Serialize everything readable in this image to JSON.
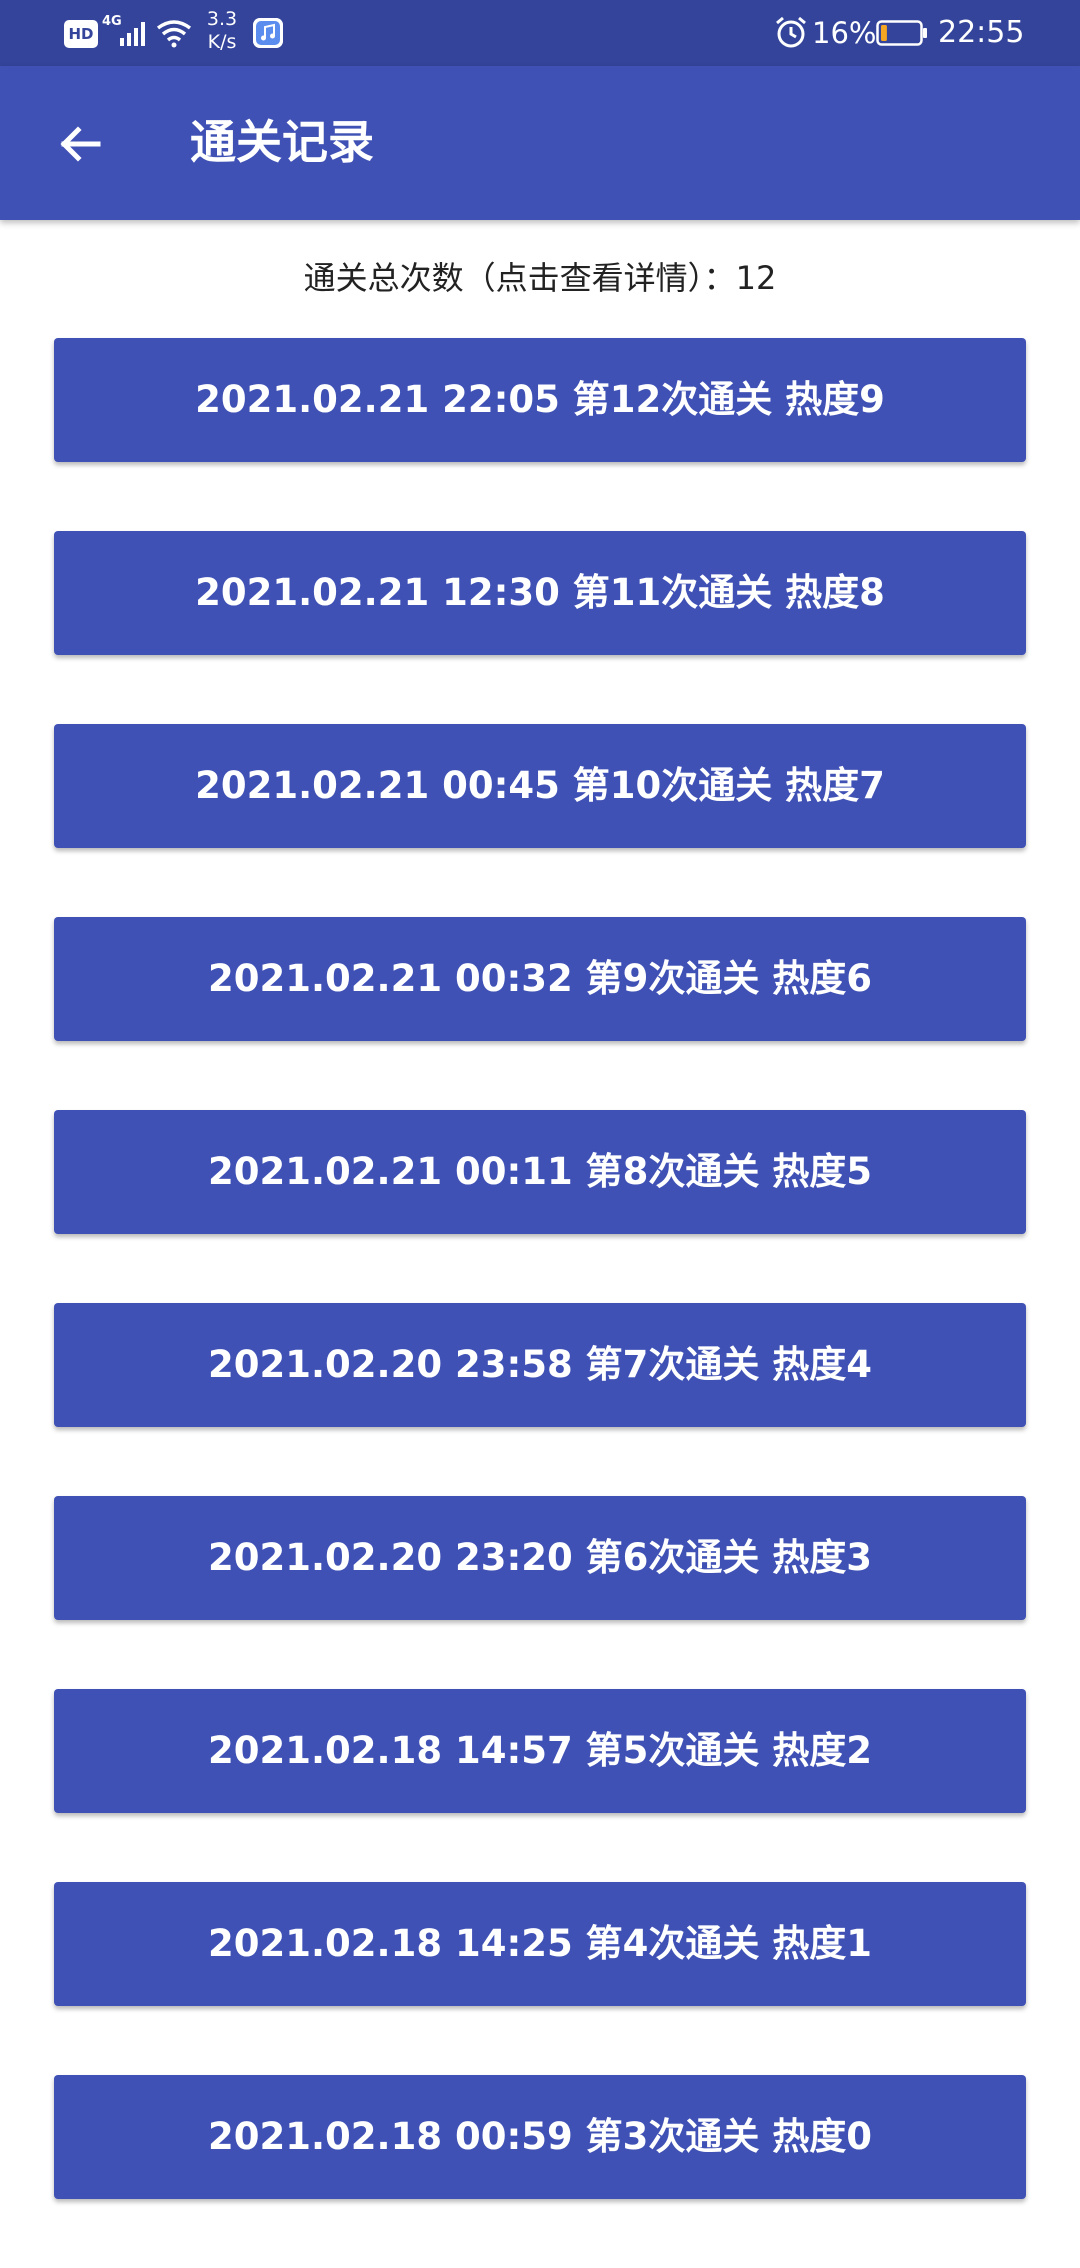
{
  "status_bar": {
    "hd": "HD",
    "network": "4G",
    "speed_value": "3.3",
    "speed_unit": "K/s",
    "battery_percent": "16%",
    "battery_level": 0.16,
    "time": "22:55",
    "icons": [
      "hd-icon",
      "signal-icon",
      "wifi-icon",
      "music-app-icon",
      "alarm-icon",
      "battery-icon"
    ]
  },
  "app_bar": {
    "back_icon": "arrow-left-icon",
    "title": "通关记录"
  },
  "summary": {
    "label": "通关总次数（点击查看详情）：",
    "count": "12"
  },
  "records": [
    {
      "label": "2021.02.21 22:05 第12次通关 热度9"
    },
    {
      "label": "2021.02.21 12:30 第11次通关 热度8"
    },
    {
      "label": "2021.02.21 00:45 第10次通关 热度7"
    },
    {
      "label": "2021.02.21 00:32 第9次通关 热度6"
    },
    {
      "label": "2021.02.21 00:11 第8次通关 热度5"
    },
    {
      "label": "2021.02.20 23:58 第7次通关 热度4"
    },
    {
      "label": "2021.02.20 23:20 第6次通关 热度3"
    },
    {
      "label": "2021.02.18 14:57 第5次通关 热度2"
    },
    {
      "label": "2021.02.18 14:25 第4次通关 热度1"
    },
    {
      "label": "2021.02.18 00:59 第3次通关 热度0"
    }
  ],
  "colors": {
    "primary": "#3f51b5",
    "status_bar": "#33449a",
    "battery_low": "#f5a623",
    "text_dark": "#222222"
  }
}
